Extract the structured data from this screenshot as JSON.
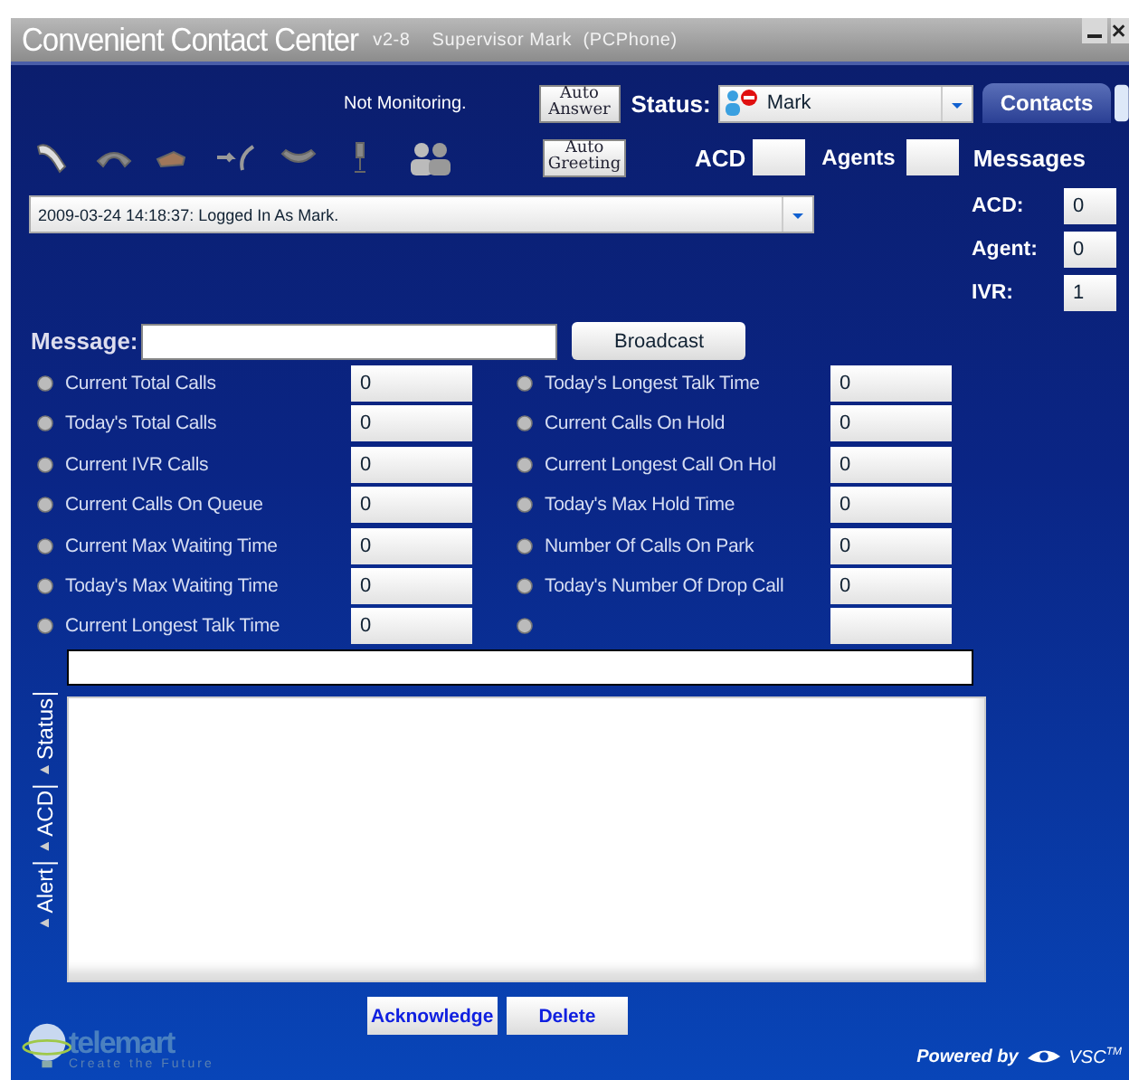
{
  "window": {
    "title": "Convenient Contact Center",
    "version": "v2-8",
    "user": "Supervisor Mark  (PCPhone)"
  },
  "toolbar": {
    "monitoring": "Not Monitoring.",
    "auto_answer": [
      "Auto",
      "Answer"
    ],
    "status_label": "Status:",
    "status_value": "Mark",
    "contacts_tab": "Contacts",
    "auto_greeting": [
      "Auto",
      "Greeting"
    ],
    "acd_label": "ACD",
    "agents_label": "Agents"
  },
  "log": {
    "value": "2009-03-24 14:18:37:  Logged In As Mark."
  },
  "messages": {
    "title": "Messages",
    "counters": [
      {
        "label": "ACD:",
        "value": "0"
      },
      {
        "label": "Agent:",
        "value": "0"
      },
      {
        "label": "IVR:",
        "value": "1"
      }
    ]
  },
  "message": {
    "label": "Message:",
    "button": "Broadcast"
  },
  "stats_left": [
    {
      "kind": "stat",
      "label": "Current Total Calls",
      "value": "0"
    },
    {
      "kind": "stat",
      "label": "Today's Total Calls",
      "value": "0"
    },
    {
      "kind": "stat",
      "label": "Current IVR Calls",
      "value": "0"
    },
    {
      "kind": "stat",
      "label": "Current Calls On Queue",
      "value": "0"
    },
    {
      "kind": "stat",
      "label": "Current Max Waiting Time",
      "value": "0"
    },
    {
      "kind": "stat",
      "label": "Today's Max Waiting Time",
      "value": "0"
    },
    {
      "kind": "stat",
      "label": "Current Longest Talk Time",
      "value": "0"
    }
  ],
  "stats_right": [
    {
      "kind": "stat",
      "label": "Today's Longest Talk Time",
      "value": "0"
    },
    {
      "kind": "stat",
      "label": "Current Calls On Hold",
      "value": "0"
    },
    {
      "kind": "stat",
      "label": "Current Longest Call On Hol",
      "value": "0"
    },
    {
      "kind": "stat",
      "label": "Today's Max Hold Time",
      "value": "0"
    },
    {
      "kind": "stat",
      "label": "Number Of Calls On Park",
      "value": "0"
    },
    {
      "kind": "stat",
      "label": "Today's Number Of Drop Call",
      "value": "0"
    },
    {
      "kind": "blank"
    }
  ],
  "side_tabs": [
    {
      "label": "Status"
    },
    {
      "label": "ACD"
    },
    {
      "label": "Alert"
    }
  ],
  "buttons": [
    "Acknowledge",
    "Delete"
  ],
  "footer": {
    "logo": "telemart",
    "slogan": "Create the Future",
    "powered": "Powered by",
    "brand": "VSC",
    "tm": "TM"
  }
}
